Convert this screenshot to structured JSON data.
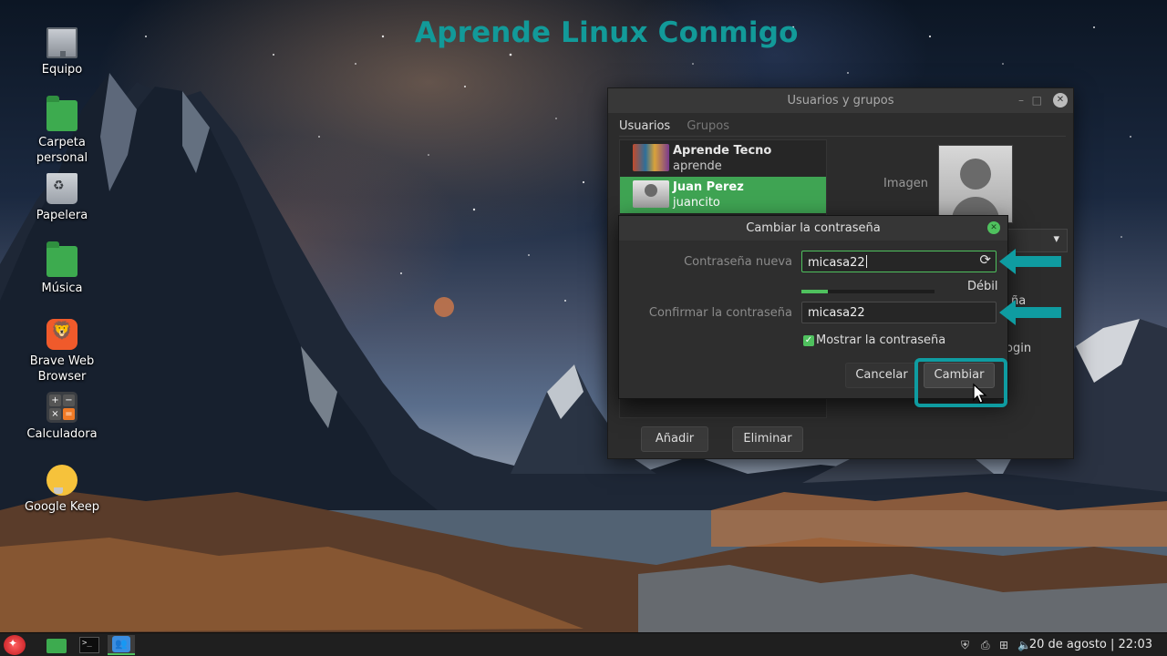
{
  "watermark": "Aprende Linux Conmigo",
  "desktop_icons": [
    {
      "label": "Equipo",
      "icon": "computer-icon"
    },
    {
      "label": "Carpeta personal",
      "icon": "home-folder-icon"
    },
    {
      "label": "Papelera",
      "icon": "trash-icon"
    },
    {
      "label": "Música",
      "icon": "music-folder-icon"
    },
    {
      "label": "Brave Web Browser",
      "icon": "brave-browser-icon"
    },
    {
      "label": "Calculadora",
      "icon": "calculator-icon"
    },
    {
      "label": "Google Keep",
      "icon": "google-keep-icon"
    }
  ],
  "window": {
    "title": "Usuarios y grupos",
    "tabs": [
      "Usuarios",
      "Grupos"
    ],
    "users": [
      {
        "name": "Aprende Tecno",
        "login": "aprende"
      },
      {
        "name": "Juan Perez",
        "login": "juancito"
      }
    ],
    "image_label": "Imagen",
    "add_button": "Añadir",
    "remove_button": "Eliminar",
    "peek_text_1": "ña",
    "peek_text_2": "ogin"
  },
  "dialog": {
    "title": "Cambiar la contraseña",
    "new_label": "Contraseña nueva",
    "new_value": "micasa22",
    "strength": "Débil",
    "strength_fraction": 0.2,
    "confirm_label": "Confirmar la contraseña",
    "confirm_value": "micasa22",
    "show_label": "Mostrar la contraseña",
    "show_checked": true,
    "cancel_button": "Cancelar",
    "ok_button": "Cambiar"
  },
  "taskbar": {
    "clock": "20 de agosto | 22:03"
  },
  "colors": {
    "accent_green": "#4fc15e",
    "annotation_teal": "#0f9ca1",
    "watermark_teal": "#129a99"
  }
}
